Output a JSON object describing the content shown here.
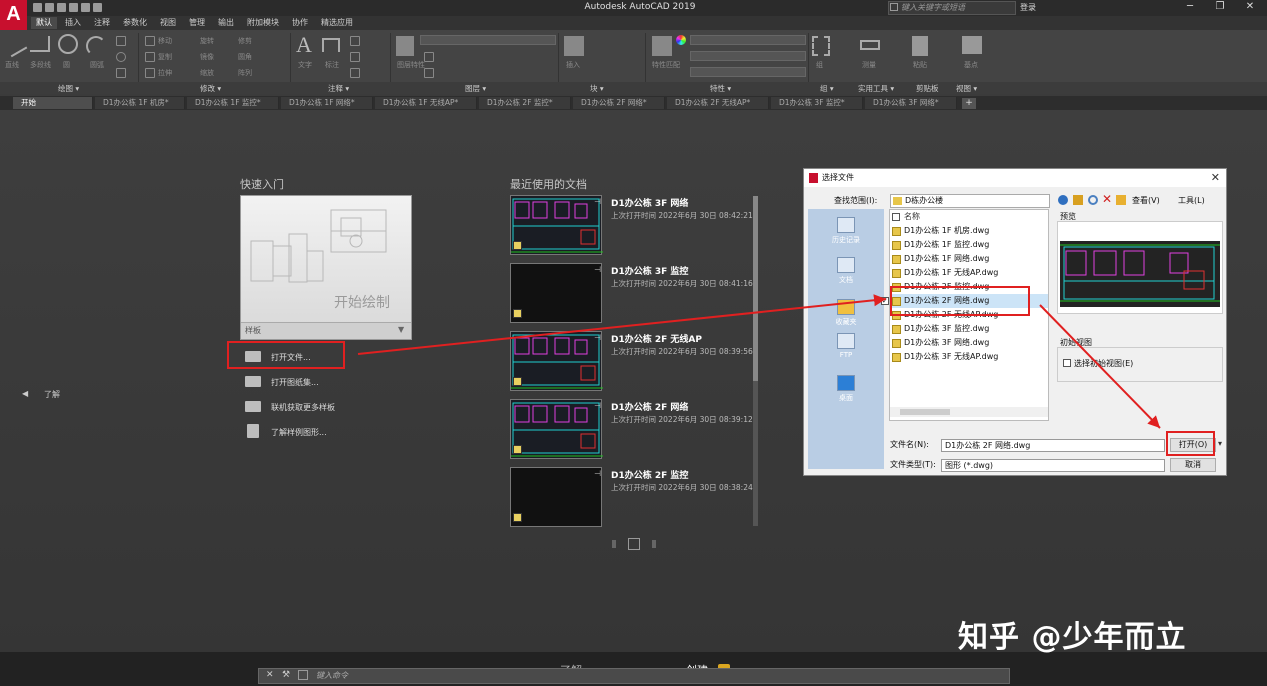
{
  "app": {
    "title": "Autodesk AutoCAD 2019",
    "logo": "A",
    "search_placeholder": "键入关键字或短语",
    "user": "登录",
    "min": "─",
    "max": "❐",
    "close": "✕"
  },
  "ribbon": {
    "tabs": [
      "默认",
      "插入",
      "注释",
      "参数化",
      "视图",
      "管理",
      "输出",
      "附加模块",
      "协作",
      "精选应用"
    ],
    "active_tab": 0,
    "panels": [
      "绘图 ▾",
      "修改 ▾",
      "注释 ▾",
      "图层 ▾",
      "块 ▾",
      "特性 ▾",
      "组 ▾",
      "实用工具 ▾",
      "剪贴板",
      "视图 ▾"
    ],
    "draw_tools": [
      "直线",
      "多段线",
      "圆",
      "圆弧"
    ],
    "modify_tools": [
      "移动",
      "旋转",
      "修剪",
      "复制",
      "镜像",
      "圆角",
      "拉伸",
      "缩放",
      "阵列"
    ],
    "annot_tools": [
      "文字",
      "标注"
    ],
    "layer_tools": [
      "图层特性"
    ],
    "block_tools": [
      "插入"
    ],
    "prop_tools": [
      "特性匹配"
    ],
    "group_tools": [
      "组"
    ],
    "util_tools": [
      "测量"
    ],
    "clip_tools": [
      "粘贴"
    ],
    "view_tools": [
      "基点"
    ]
  },
  "doc_tabs": [
    "开始",
    "D1办公栋 1F 机房*",
    "D1办公栋 1F 监控*",
    "D1办公栋 1F 网络*",
    "D1办公栋 1F 无线AP*",
    "D1办公栋 2F 监控*",
    "D1办公栋 2F 网络*",
    "D1办公栋 2F 无线AP*",
    "D1办公栋 3F 监控*",
    "D1办公栋 3F 网络*"
  ],
  "start": {
    "learn_left": "了解",
    "quick_title": "快速入门",
    "start_drawing": "开始绘制",
    "templates_label": "样板",
    "links": [
      "打开文件...",
      "打开图纸集...",
      "联机获取更多样板",
      "了解样例图形..."
    ],
    "recent_title": "最近使用的文档",
    "recent": [
      {
        "title": "D1办公栋 3F 网络",
        "time": "上次打开时间 2022年6月 30日 08:42:21",
        "dark": false
      },
      {
        "title": "D1办公栋 3F 监控",
        "time": "上次打开时间 2022年6月 30日 08:41:16",
        "dark": true
      },
      {
        "title": "D1办公栋 2F 无线AP",
        "time": "上次打开时间 2022年6月 30日 08:39:56",
        "dark": false
      },
      {
        "title": "D1办公栋 2F 网络",
        "time": "上次打开时间 2022年6月 30日 08:39:12",
        "dark": false
      },
      {
        "title": "D1办公栋 2F 监控",
        "time": "上次打开时间 2022年6月 30日 08:38:24",
        "dark": true
      }
    ]
  },
  "dialog": {
    "title": "选择文件",
    "lookin_label": "查找范围(I):",
    "lookin_value": "D栋办公楼",
    "views_label": "查看(V)",
    "tools_label": "工具(L)",
    "places": [
      "历史记录",
      "文档",
      "收藏夹",
      "FTP",
      "桌面"
    ],
    "col_name": "名称",
    "files": [
      "D1办公栋 1F 机房.dwg",
      "D1办公栋 1F 监控.dwg",
      "D1办公栋 1F 网络.dwg",
      "D1办公栋 1F 无线AP.dwg",
      "D1办公栋 2F 监控.dwg",
      "D1办公栋 2F 网络.dwg",
      "D1办公栋 2F 无线AP.dwg",
      "D1办公栋 3F 监控.dwg",
      "D1办公栋 3F 网络.dwg",
      "D1办公栋 3F 无线AP.dwg"
    ],
    "selected_index": 5,
    "preview_label": "预览",
    "initview_label": "初始视图",
    "initview_check": "选择初始视图(E)",
    "fname_label": "文件名(N):",
    "fname_value": "D1办公栋 2F 网络.dwg",
    "ftype_label": "文件类型(T):",
    "ftype_value": "图形 (*.dwg)",
    "open_btn": "打开(O)",
    "cancel_btn": "取消"
  },
  "bottom": {
    "learn": "了解",
    "create": "创建",
    "cmd_placeholder": "键入命令"
  },
  "watermark": "知乎 @少年而立"
}
